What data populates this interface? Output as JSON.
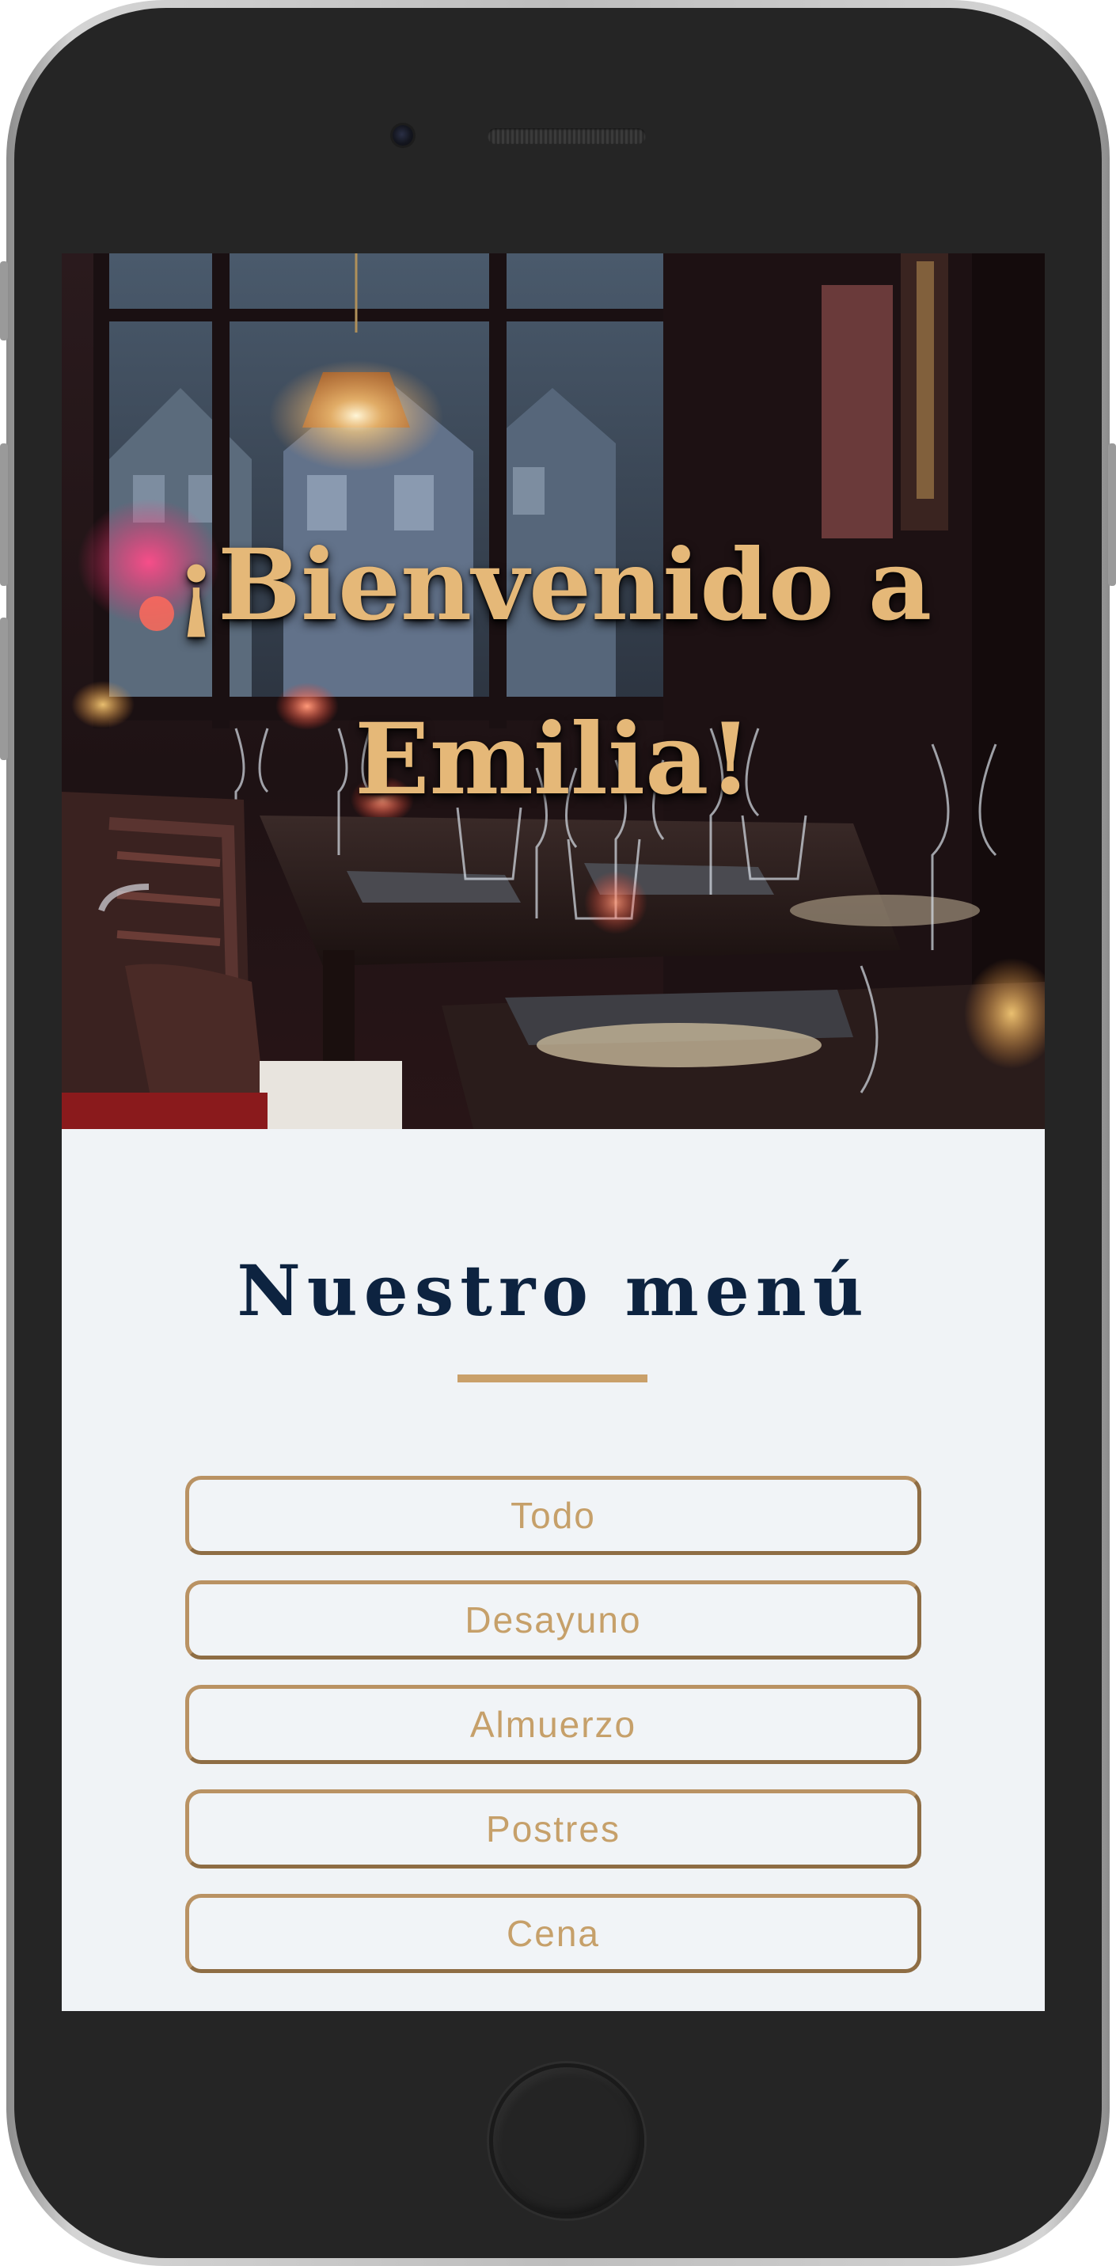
{
  "hero": {
    "title": "¡Bienvenido a Emilia!"
  },
  "menu": {
    "title": "Nuestro menú",
    "buttons": [
      {
        "label": "Todo"
      },
      {
        "label": "Desayuno"
      },
      {
        "label": "Almuerzo"
      },
      {
        "label": "Postres"
      },
      {
        "label": "Cena"
      }
    ]
  },
  "colors": {
    "accent_gold": "#c9a06a",
    "title_navy": "#0d2340",
    "screen_bg": "#f0f3f6",
    "device_body": "#252525"
  },
  "icons": {
    "camera": "front-camera-icon",
    "speaker": "earpiece-speaker-icon",
    "home": "home-button-icon"
  }
}
